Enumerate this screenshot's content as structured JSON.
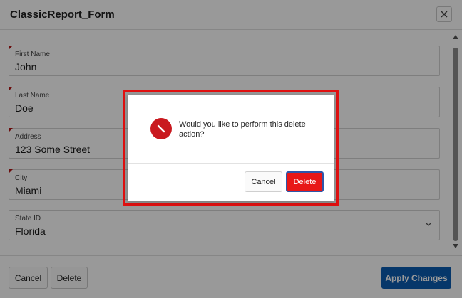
{
  "dialog": {
    "title": "ClassicReport_Form",
    "close_icon": "close-icon"
  },
  "fields": [
    {
      "label": "First Name",
      "value": "John",
      "required": true
    },
    {
      "label": "Last Name",
      "value": "Doe",
      "required": true
    },
    {
      "label": "Address",
      "value": "123 Some Street",
      "required": true
    },
    {
      "label": "City",
      "value": "Miami",
      "required": true
    },
    {
      "label": "State ID",
      "value": "Florida",
      "required": false,
      "type": "select"
    }
  ],
  "footer": {
    "cancel_label": "Cancel",
    "delete_label": "Delete",
    "apply_label": "Apply Changes"
  },
  "confirm": {
    "message": "Would you like to perform this delete action?",
    "cancel_label": "Cancel",
    "delete_label": "Delete",
    "icon": "no-entry-icon"
  },
  "colors": {
    "primary": "#0a5cb1",
    "danger": "#e81717",
    "required_marker": "#b31515",
    "highlight": "#e01010"
  }
}
